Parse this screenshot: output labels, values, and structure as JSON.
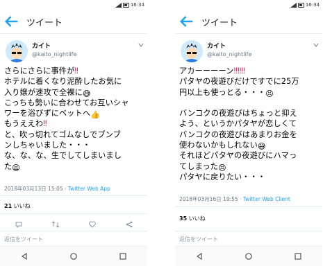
{
  "left": {
    "status_time": "16:34",
    "title": "ツイート",
    "user": {
      "name": "カイト",
      "handle": "@kaito_nightlife"
    },
    "lines": [
      [
        "さらにさらに事件が",
        "‼"
      ],
      [
        "ホテルに着くなり泥酔したお気に",
        ""
      ],
      [
        "入り嬢が速攻で全裸に",
        "😅"
      ],
      [
        "こっちも勢いに合わせてお互いシャ",
        ""
      ],
      [
        "ワーを浴びずにベットへ",
        "👍"
      ],
      [
        "もうええわ",
        "‼"
      ],
      [
        "と、吹っ切れてゴムなしでブンブ",
        ""
      ],
      [
        "ンしちゃいました・・・",
        ""
      ],
      [
        "な、な、な、生でしてしまいまし",
        ""
      ],
      [
        "た",
        "😫"
      ]
    ],
    "timestamp": "2018年03月13日 15:05 · ",
    "source": "Twitter Web App",
    "likes_count": "21",
    "likes_label": " いいね",
    "reply_placeholder": "返信をツイート"
  },
  "right": {
    "status_time": "16:34",
    "title": "ツイート",
    "user": {
      "name": "カイト",
      "handle": "@kaito_nightlife"
    },
    "lines": [
      [
        "アカーーーーン",
        "‼‼‼"
      ],
      [
        "パタヤの夜遊びだけですでに25万",
        ""
      ],
      [
        "円以上も使っとる・・・",
        "😣"
      ],
      [
        "",
        ""
      ],
      [
        "バンコクの夜遊びはちょっと抑え",
        ""
      ],
      [
        "よう、というかパタヤが恋しくて",
        ""
      ],
      [
        "バンコクの夜遊びはあまりお金を",
        ""
      ],
      [
        "使わないかもしれない",
        "😅"
      ],
      [
        "それほどパタヤの夜遊びにハマっ",
        ""
      ],
      [
        "てしまった",
        "😣"
      ],
      [
        "パタヤに戻りたい・・・",
        ""
      ]
    ],
    "timestamp": "2018年03月16日 19:55 · ",
    "source": "Twitter Web Client",
    "likes_count": "35",
    "likes_label": " いいね",
    "reply_placeholder": "返信をツイート"
  },
  "colors": {
    "accent": "#1DA1F2",
    "muted": "#657786",
    "emphasis": "#e0245e"
  },
  "icons": [
    "back-arrow-icon",
    "chevron-down-icon",
    "reply-icon",
    "retweet-icon",
    "like-icon",
    "share-icon",
    "nav-back-icon",
    "nav-home-icon",
    "nav-recents-icon"
  ]
}
